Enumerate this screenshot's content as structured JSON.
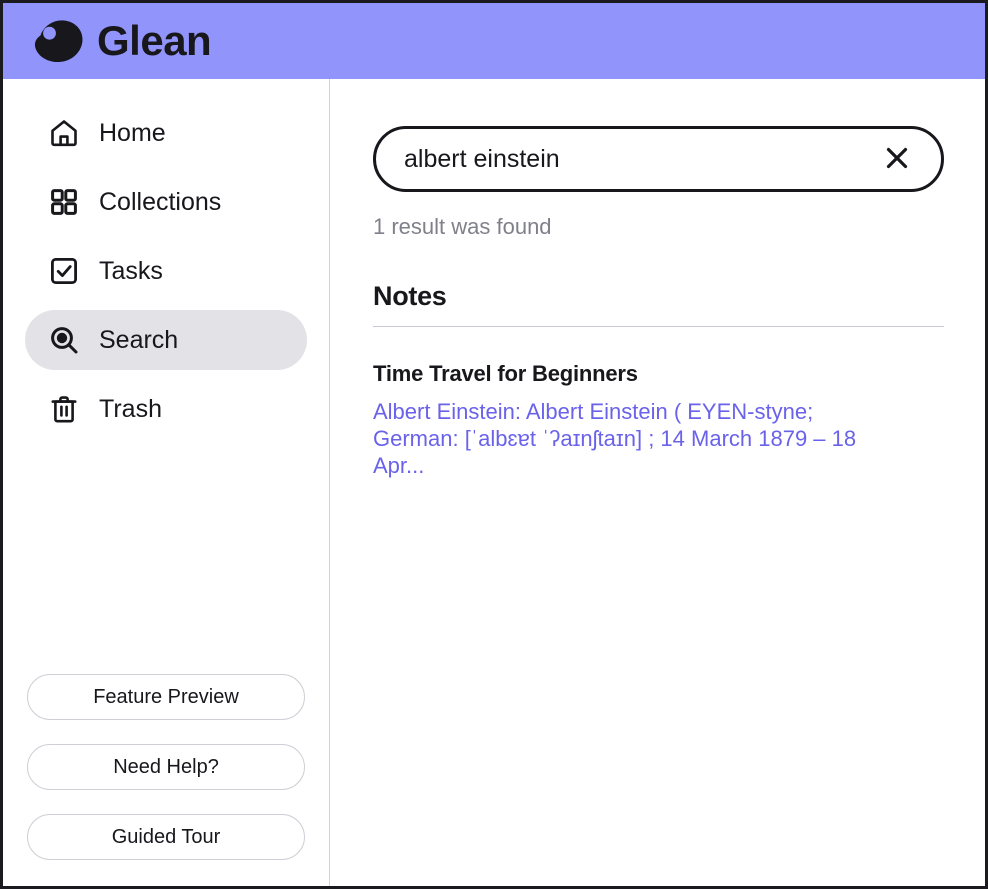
{
  "header": {
    "brand_name": "Glean",
    "background_color": "#9194FB",
    "logo_icon": "glean-blob-logo"
  },
  "sidebar": {
    "items": [
      {
        "label": "Home",
        "icon": "home-icon",
        "active": false
      },
      {
        "label": "Collections",
        "icon": "grid-icon",
        "active": false
      },
      {
        "label": "Tasks",
        "icon": "checkbox-icon",
        "active": false
      },
      {
        "label": "Search",
        "icon": "search-icon",
        "active": true
      },
      {
        "label": "Trash",
        "icon": "trash-icon",
        "active": false
      }
    ],
    "actions": [
      {
        "label": "Feature Preview"
      },
      {
        "label": "Need Help?"
      },
      {
        "label": "Guided Tour"
      }
    ],
    "active_item_background": "#E3E3E7"
  },
  "search": {
    "value": "albert einstein",
    "placeholder": "Search",
    "clear_icon": "close-icon",
    "result_count_text": "1 result was found"
  },
  "results": {
    "section_title": "Notes",
    "items": [
      {
        "title": "Time Travel for Beginners",
        "snippet": "Albert Einstein: Albert Einstein ( EYEN-styne; German: [ˈalbɛɐt ˈʔaɪnʃtaɪn] ; 14 March 1879 – 18 Apr...",
        "snippet_color": "#6A62EA"
      }
    ]
  }
}
